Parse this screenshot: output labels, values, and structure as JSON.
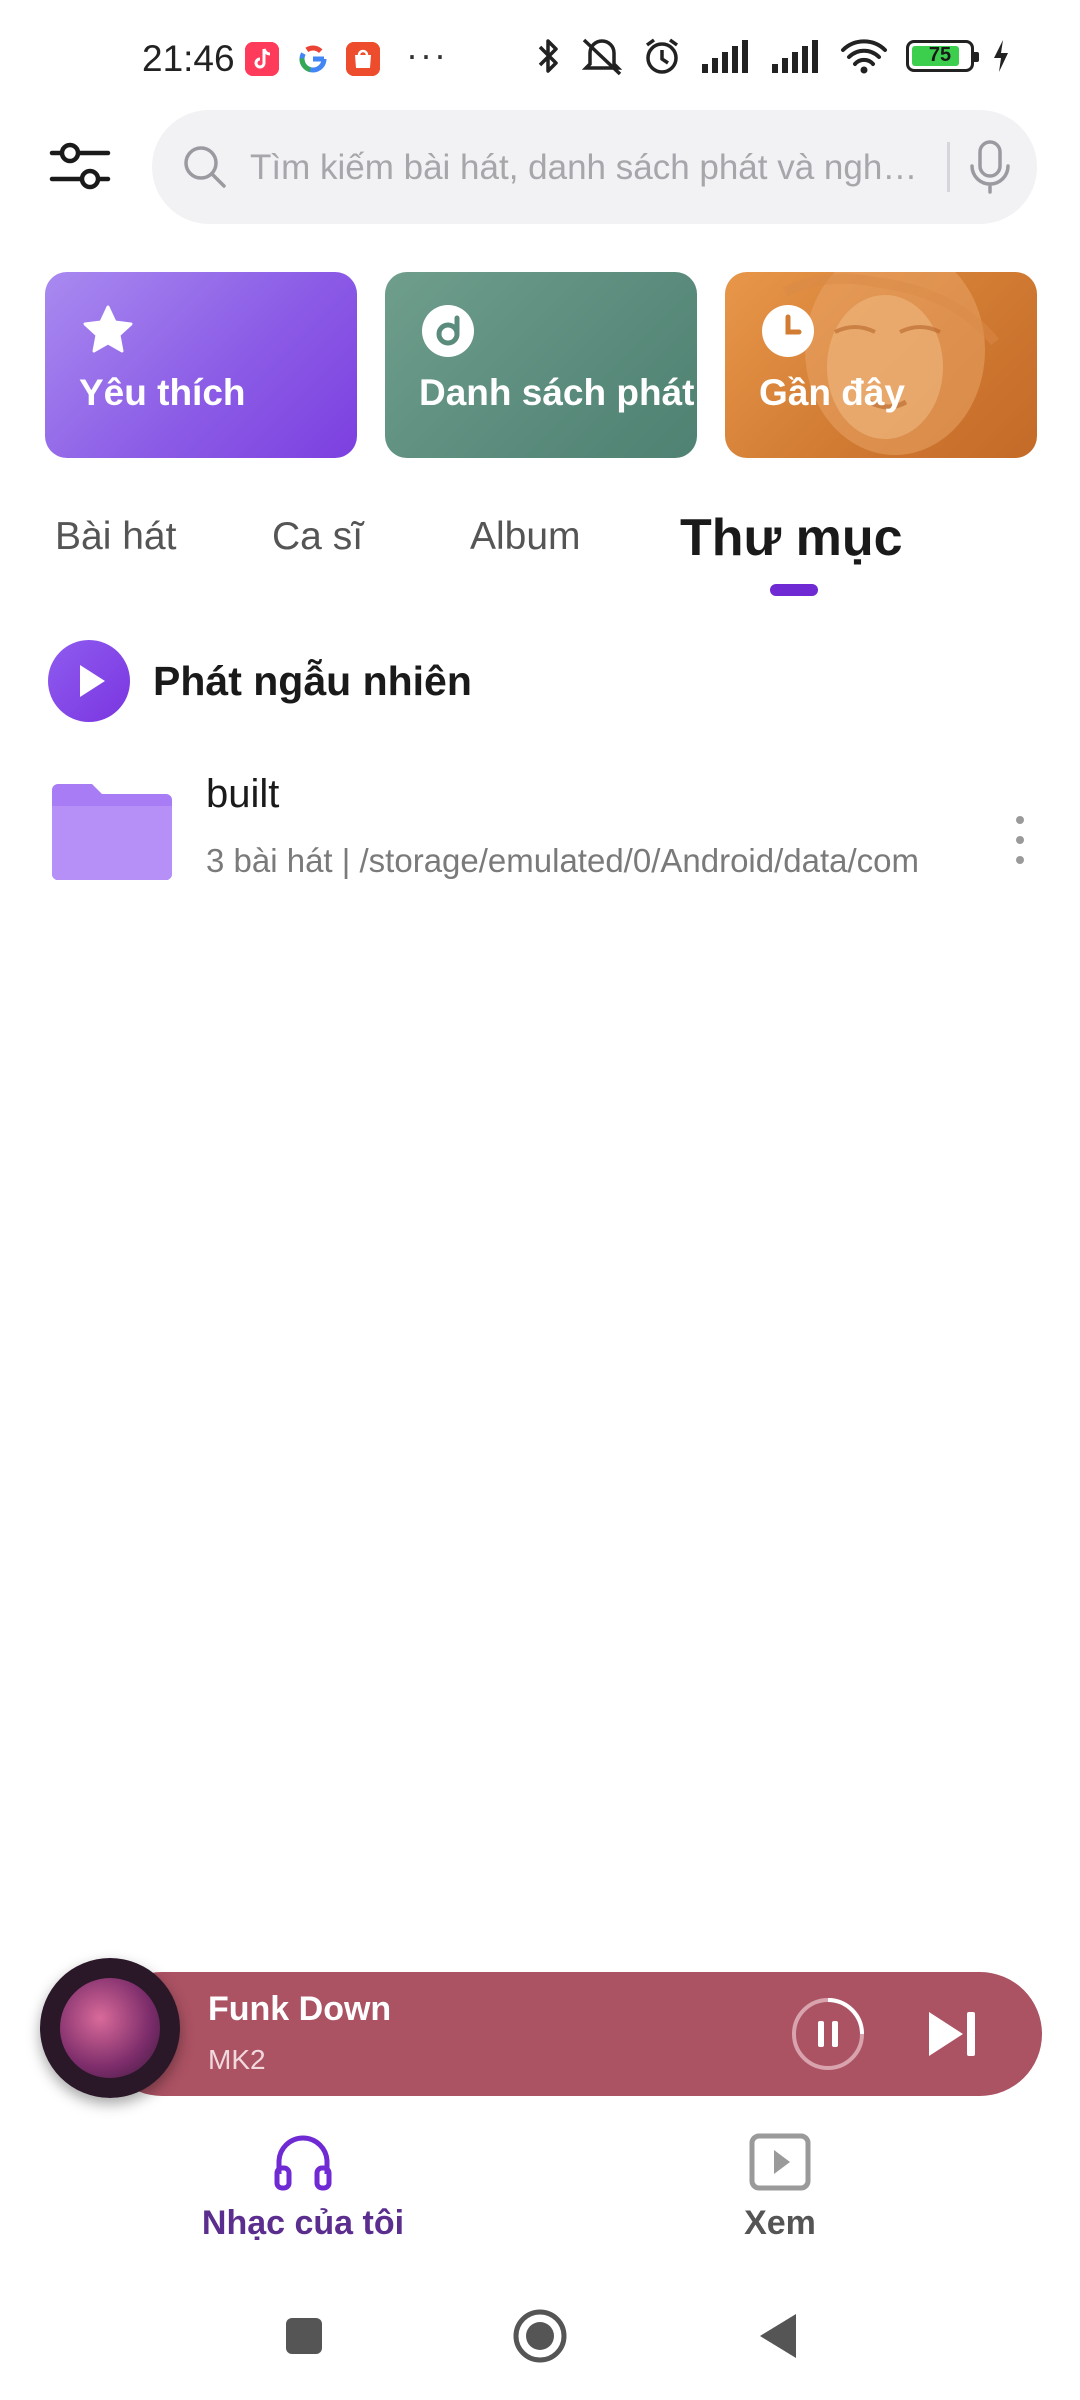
{
  "status_bar": {
    "time": "21:46",
    "more": "···",
    "battery_level": "75",
    "icons": [
      "tiktok-icon",
      "google-icon",
      "shopee-icon",
      "bluetooth-icon",
      "silent-icon",
      "alarm-icon",
      "signal-icon",
      "signal-icon",
      "wifi-icon",
      "battery-icon",
      "charging-icon"
    ]
  },
  "header": {
    "search_placeholder": "Tìm kiếm bài hát, danh sách phát và nghệ sĩ"
  },
  "quick_cards": [
    {
      "label": "Yêu thích",
      "icon": "star-icon"
    },
    {
      "label": "Danh sách phát",
      "icon": "music-disc-icon"
    },
    {
      "label": "Gần đây",
      "icon": "clock-icon"
    }
  ],
  "tabs": [
    {
      "label": "Bài hát"
    },
    {
      "label": "Ca sĩ"
    },
    {
      "label": "Album"
    },
    {
      "label": "Thư mục",
      "active": true
    }
  ],
  "shuffle": {
    "label": "Phát ngẫu nhiên"
  },
  "folders": [
    {
      "name": "built",
      "subtitle": "3 bài hát | /storage/emulated/0/Android/data/com"
    }
  ],
  "player": {
    "title": "Funk Down",
    "artist": "MK2"
  },
  "bottom_nav": [
    {
      "label": "Nhạc của tôi",
      "active": true
    },
    {
      "label": "Xem"
    }
  ],
  "colors": {
    "accent": "#6f2ad4",
    "favorites_card": "#8c5de6",
    "playlist_card": "#5a8b7c",
    "recent_card": "#d17b33",
    "player_bg": "#ab5263"
  }
}
